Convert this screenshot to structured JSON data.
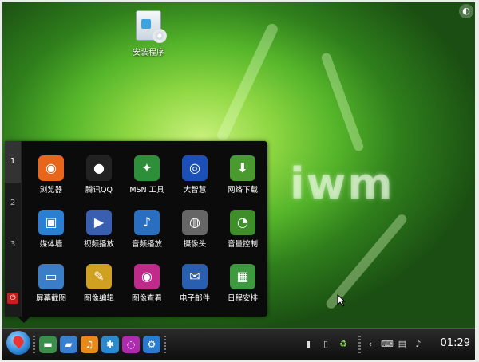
{
  "desktop": {
    "icon_label": "安装程序",
    "logo_text": "iwm"
  },
  "menu": {
    "tabs": [
      "1",
      "2",
      "3"
    ],
    "power_icon": "power-icon",
    "apps": [
      {
        "label": "浏览器",
        "icon": "firefox-icon",
        "color": "#e8661b",
        "glyph": "◉"
      },
      {
        "label": "腾讯QQ",
        "icon": "qq-penguin-icon",
        "color": "#222222",
        "glyph": "●"
      },
      {
        "label": "MSN 工具",
        "icon": "msn-bird-icon",
        "color": "#2e8f3a",
        "glyph": "✦"
      },
      {
        "label": "大智慧",
        "icon": "dazhihui-icon",
        "color": "#1d4fb8",
        "glyph": "◎"
      },
      {
        "label": "网络下载",
        "icon": "download-icon",
        "color": "#4a9b2f",
        "glyph": "⬇"
      },
      {
        "label": "媒体墙",
        "icon": "media-wall-icon",
        "color": "#2b7fd0",
        "glyph": "▣"
      },
      {
        "label": "视频播放",
        "icon": "video-player-icon",
        "color": "#3a5fb0",
        "glyph": "▶"
      },
      {
        "label": "音频播放",
        "icon": "audio-player-icon",
        "color": "#2a6fbf",
        "glyph": "♪"
      },
      {
        "label": "摄像头",
        "icon": "webcam-icon",
        "color": "#666666",
        "glyph": "◍"
      },
      {
        "label": "音量控制",
        "icon": "volume-control-icon",
        "color": "#3e8f2a",
        "glyph": "◔"
      },
      {
        "label": "屏幕截图",
        "icon": "screenshot-icon",
        "color": "#3a7ec8",
        "glyph": "▭"
      },
      {
        "label": "图像编辑",
        "icon": "image-edit-icon",
        "color": "#d0a020",
        "glyph": "✎"
      },
      {
        "label": "图像查看",
        "icon": "image-view-icon",
        "color": "#c02a8a",
        "glyph": "◉"
      },
      {
        "label": "电子邮件",
        "icon": "email-icon",
        "color": "#2a5fb0",
        "glyph": "✉"
      },
      {
        "label": "日程安排",
        "icon": "calendar-icon",
        "color": "#3e9a3e",
        "glyph": "▦"
      }
    ]
  },
  "taskbar": {
    "quicklaunch": [
      {
        "icon": "desktop-icon",
        "color": "#3a8f4a",
        "glyph": "▬"
      },
      {
        "icon": "folder-icon",
        "color": "#3a7ed0",
        "glyph": "▰"
      },
      {
        "icon": "music-icon",
        "color": "#e88a1a",
        "glyph": "♫"
      },
      {
        "icon": "browser-globe-icon",
        "color": "#2a8ad0",
        "glyph": "✱"
      },
      {
        "icon": "chat-icon",
        "color": "#b02ab0",
        "glyph": "◌"
      },
      {
        "icon": "settings-icon",
        "color": "#2a7ad0",
        "glyph": "⚙"
      }
    ],
    "tray_left": [
      {
        "icon": "battery-icon",
        "glyph": "▮"
      },
      {
        "icon": "trash-icon",
        "glyph": "▯"
      },
      {
        "icon": "recycle-icon",
        "glyph": "♻"
      }
    ],
    "tray_right": [
      {
        "icon": "chevron-left-icon",
        "glyph": "‹"
      },
      {
        "icon": "keyboard-icon",
        "glyph": "⌨"
      },
      {
        "icon": "network-icon",
        "glyph": "▤"
      },
      {
        "icon": "speaker-icon",
        "glyph": "♪"
      }
    ],
    "clock": "01:29"
  }
}
